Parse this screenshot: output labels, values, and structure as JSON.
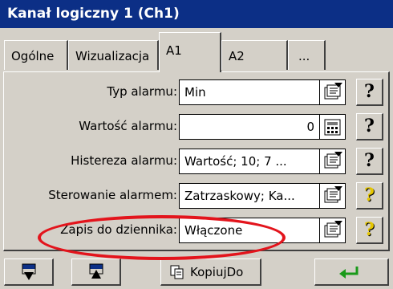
{
  "window": {
    "title": "Kanał logiczny 1 (Ch1)"
  },
  "tabs": [
    {
      "label": "Ogólne"
    },
    {
      "label": "Wizualizacja"
    },
    {
      "label": "A1"
    },
    {
      "label": "A2"
    },
    {
      "label": "..."
    }
  ],
  "fields": [
    {
      "label": "Typ alarmu:",
      "value": "Min",
      "icon": "list-picker-icon",
      "align": "left"
    },
    {
      "label": "Wartość alarmu:",
      "value": "0",
      "icon": "keypad-icon",
      "align": "right"
    },
    {
      "label": "Histereza alarmu:",
      "value": "Wartość; 10; 7 ...",
      "icon": "list-picker-icon",
      "align": "left"
    },
    {
      "label": "Sterowanie alarmem:",
      "value": "Zatrzaskowy; Ka...",
      "icon": "list-picker-icon",
      "align": "left"
    },
    {
      "label": "Zapis do dziennika:",
      "value": "Włączone",
      "icon": "list-picker-icon",
      "align": "left"
    }
  ],
  "help": {
    "glyph": "?"
  },
  "bottom": {
    "copy_label": "KopiujDo"
  },
  "colors": {
    "titlebar": "#0c2f86",
    "highlight_ellipse": "#e3141c",
    "help_active": "#e5c600"
  }
}
